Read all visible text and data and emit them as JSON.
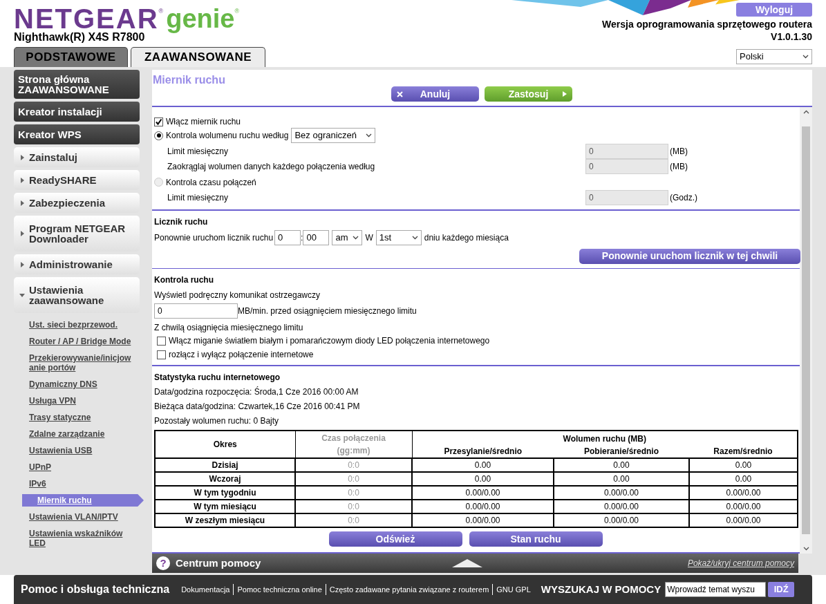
{
  "header": {
    "brand": "NETGEAR",
    "brand_mark": "®",
    "product": "genie",
    "product_mark": "®",
    "model": "Nighthawk(R) X4S R7800",
    "logout": "Wyloguj",
    "firmware_label": "Wersja oprogramowania sprzętowego routera",
    "firmware_version": "V1.0.1.30",
    "language": "Polski"
  },
  "tabs": [
    {
      "label": "PODSTAWOWE",
      "selected": false
    },
    {
      "label": "ZAAWANSOWANE",
      "selected": true
    }
  ],
  "sidebar": {
    "items": [
      {
        "kind": "dark",
        "label": "Strona główna ZAAWANSOWANE"
      },
      {
        "kind": "dark",
        "label": "Kreator instalacji"
      },
      {
        "kind": "dark",
        "label": "Kreator WPS"
      },
      {
        "kind": "group",
        "label": "Zainstaluj",
        "expanded": false
      },
      {
        "kind": "group",
        "label": "ReadySHARE",
        "expanded": false
      },
      {
        "kind": "group",
        "label": "Zabezpieczenia",
        "expanded": false
      },
      {
        "kind": "group",
        "label": "Program NETGEAR Downloader",
        "expanded": false
      },
      {
        "kind": "group",
        "label": "Administrowanie",
        "expanded": false
      },
      {
        "kind": "group",
        "label": "Ustawienia zaawansowane",
        "expanded": true,
        "children": [
          {
            "label": "Ust. sieci bezprzewod.",
            "selected": false
          },
          {
            "label": "Router / AP / Bridge Mode",
            "selected": false
          },
          {
            "label": "Przekierowywanie/inicjowanie portów",
            "selected": false
          },
          {
            "label": "Dynamiczny DNS",
            "selected": false
          },
          {
            "label": "Usługa VPN",
            "selected": false
          },
          {
            "label": "Trasy statyczne",
            "selected": false
          },
          {
            "label": "Zdalne zarządzanie",
            "selected": false
          },
          {
            "label": "Ustawienia USB",
            "selected": false
          },
          {
            "label": "UPnP",
            "selected": false
          },
          {
            "label": "IPv6",
            "selected": false
          },
          {
            "label": "Miernik ruchu",
            "selected": true
          },
          {
            "label": "Ustawienia VLAN/IPTV",
            "selected": false
          },
          {
            "label": "Ustawienia wskaźników LED",
            "selected": false
          }
        ]
      }
    ]
  },
  "page": {
    "title": "Miernik ruchu",
    "cancel": "Anuluj",
    "apply": "Zastosuj",
    "meter": {
      "enable": {
        "label": "Włącz miernik ruchu",
        "checked": true
      },
      "volume": {
        "label": "Kontrola wolumenu ruchu według",
        "selected": true,
        "select": "Bez ograniczeń"
      },
      "volume_rows": [
        {
          "label": "Limit miesięczny",
          "value": "0",
          "unit": "(MB)",
          "disabled": true
        },
        {
          "label": "Zaokrąglaj wolumen danych każdego połączenia według",
          "value": "0",
          "unit": "(MB)",
          "disabled": true
        }
      ],
      "time": {
        "label": "Kontrola czasu połączeń",
        "selected": false,
        "disabled": true
      },
      "time_rows": [
        {
          "label": "Limit miesięczny",
          "value": "0",
          "unit": "(Godz.)",
          "disabled": true
        }
      ]
    },
    "counter": {
      "title": "Licznik ruchu",
      "label": "Ponownie uruchom licznik ruchu",
      "hour": "0",
      "separator": ":",
      "minute": "00",
      "ampm": "am",
      "on": "W",
      "day": "1st",
      "suffix": "dniu każdego miesiąca",
      "restart": "Ponownie uruchom licznik w tej chwili"
    },
    "control": {
      "title": "Kontrola ruchu",
      "warning": "Wyświetl podręczny komunikat ostrzegawczy",
      "value": "0",
      "value_suffix": "MB/min. przed osiągnięciem miesięcznego limitu",
      "on_limit": "Z chwilą osiągnięcia miesięcznego limitu",
      "options": [
        {
          "label": "Włącz miganie światłem białym i pomarańczowym diody LED połączenia internetowego",
          "checked": false
        },
        {
          "label": "rozłącz i wyłącz połączenie internetowe",
          "checked": false
        }
      ]
    },
    "stats": {
      "title": "Statystyka ruchu internetowego",
      "lines": [
        "Data/godzina rozpoczęcia: Środa,1 Cze 2016 00:00 AM",
        "Bieżąca data/godzina: Czwartek,16 Cze 2016 00:41 PM",
        "Pozostały wolumen ruchu: 0 Bajty"
      ],
      "columns": {
        "period": "Okres",
        "time": "Czas połączenia (gg:mm)",
        "volume": "Wolumen ruchu (MB)",
        "upload": "Przesylanie/średnio",
        "download": "Pobieranie/średnio",
        "total": "Razem/średnio"
      },
      "rows": [
        {
          "period": "Dzisiaj",
          "time": "0:0",
          "upload": "0.00",
          "download": "0.00",
          "total": "0.00"
        },
        {
          "period": "Wczoraj",
          "time": "0:0",
          "upload": "0.00",
          "download": "0.00",
          "total": "0.00"
        },
        {
          "period": "W tym tygodniu",
          "time": "0:0",
          "upload": "0.00/0.00",
          "download": "0.00/0.00",
          "total": "0.00/0.00"
        },
        {
          "period": "W tym miesiącu",
          "time": "0:0",
          "upload": "0.00/0.00",
          "download": "0.00/0.00",
          "total": "0.00/0.00"
        },
        {
          "period": "W zeszłym miesiącu",
          "time": "0:0",
          "upload": "0.00/0.00",
          "download": "0.00/0.00",
          "total": "0.00/0.00"
        }
      ],
      "buttons": [
        "Odśwież",
        "Stan ruchu"
      ]
    }
  },
  "help_bar": {
    "icon": "?",
    "title": "Centrum pomocy",
    "toggle": "Pokaż/ukryj centrum pomocy"
  },
  "footer": {
    "title": "Pomoc i obsługa techniczna",
    "links": [
      "Dokumentacja",
      "Pomoc techniczna online",
      "Często zadawane pytania związane z routerem",
      "GNU GPL"
    ],
    "search_label": "WYSZUKAJ W POMOCY",
    "search_placeholder": "Wprowadź temat wyszu",
    "search_button": "IDŹ"
  }
}
